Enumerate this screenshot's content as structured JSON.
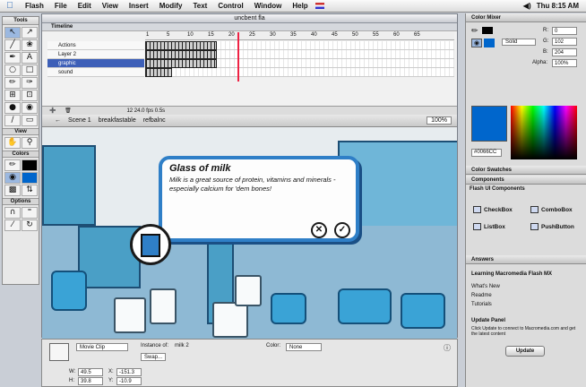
{
  "menubar": {
    "items": [
      "Flash",
      "File",
      "Edit",
      "View",
      "Insert",
      "Modify",
      "Text",
      "Control",
      "Window",
      "Help"
    ],
    "clock": "Thu 8:15 AM",
    "volume_icon": "speaker-icon"
  },
  "tools": {
    "title": "Tools",
    "view_label": "View",
    "colors_label": "Colors",
    "options_label": "Options"
  },
  "document": {
    "title": "uncbent fla",
    "timeline_label": "Timeline",
    "ruler": [
      "1",
      "5",
      "10",
      "15",
      "20",
      "25",
      "30",
      "35",
      "40",
      "45",
      "50",
      "55",
      "60",
      "65"
    ],
    "layers": [
      "Actions",
      "Layer 2",
      "graphic",
      "sound"
    ],
    "footer": "12   24.0 fps   0.5s",
    "scenes": [
      "Scene 1",
      "breakfastable",
      "refbalnc"
    ],
    "zoom": "100%"
  },
  "stage": {
    "bubble_title": "Glass of milk",
    "bubble_body": "Milk is a great source of protein, vitamins and minerals - especially calcium for 'dem bones!"
  },
  "properties": {
    "type": "Movie Clip",
    "instance_label": "Instance of:",
    "instance_value": "milk 2",
    "swap_label": "Swap...",
    "color_label": "Color:",
    "color_value": "None",
    "w_label": "W:",
    "w_value": "49.5",
    "x_label": "X:",
    "x_value": "-151.3",
    "h_label": "H:",
    "h_value": "39.8",
    "y_label": "Y:",
    "y_value": "-10.9"
  },
  "color_mixer": {
    "title": "Color Mixer",
    "mode": "Solid",
    "r_label": "R:",
    "r_value": "0",
    "g_label": "G:",
    "g_value": "102",
    "b_label": "B:",
    "b_value": "204",
    "alpha_label": "Alpha:",
    "alpha_value": "100%",
    "hex": "#0066CC",
    "swatch_color": "#0066CC"
  },
  "panels": {
    "swatches": "Color Swatches",
    "components": "Components",
    "components_group": "Flash UI Components",
    "component_items": [
      "CheckBox",
      "ComboBox",
      "ListBox",
      "PushButton"
    ],
    "answers": "Answers",
    "answers_heading": "Learning Macromedia Flash MX",
    "answers_links": [
      "What's New",
      "Readme",
      "Tutorials"
    ],
    "update_heading": "Update Panel",
    "update_body": "Click Update to connect to Macromedia.com and get the latest content",
    "update_button": "Update"
  }
}
